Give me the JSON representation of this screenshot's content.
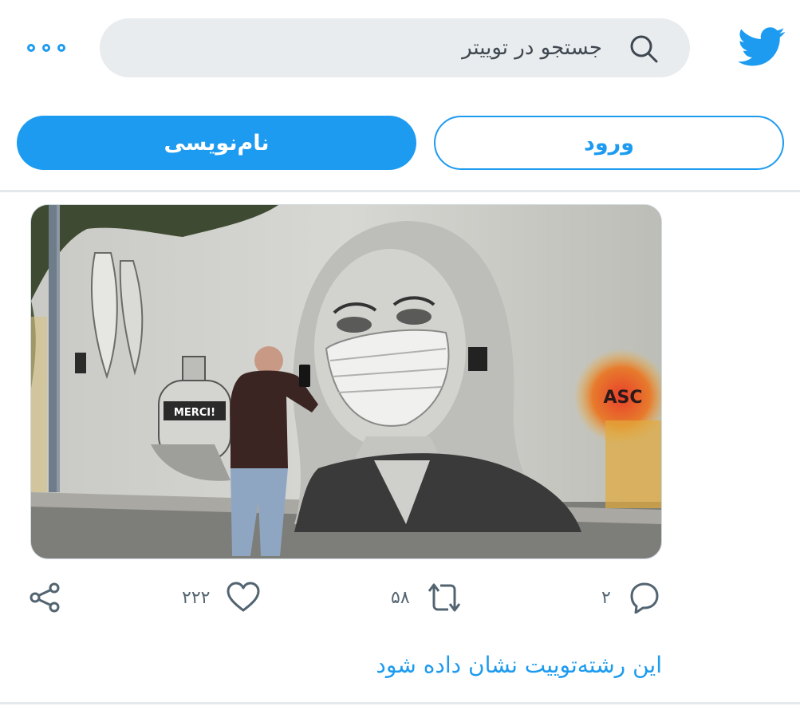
{
  "header": {
    "search": {
      "placeholder": "جستجو در توییتر"
    },
    "icons": {
      "logo": "twitter-bird-icon",
      "more": "more-horizontal-icon",
      "search": "search-icon"
    }
  },
  "auth": {
    "signup_label": "نام‌نویسی",
    "login_label": "ورود"
  },
  "tweet": {
    "media": {
      "content": "photo",
      "sign_text": "MERCI!",
      "tag_text": "ASC"
    },
    "actions": {
      "share": {
        "icon": "share-icon"
      },
      "like": {
        "icon": "heart-icon",
        "count": "۲۲۲"
      },
      "retweet": {
        "icon": "retweet-icon",
        "count": "۵۸"
      },
      "reply": {
        "icon": "reply-icon",
        "count": "۲"
      }
    },
    "thread_link": "این رشته‌توییت نشان داده شود"
  },
  "colors": {
    "accent": "#1d9bf0",
    "search_bg": "#e8ecef",
    "divider": "#e6e9eb",
    "icon_gray": "#536471"
  }
}
